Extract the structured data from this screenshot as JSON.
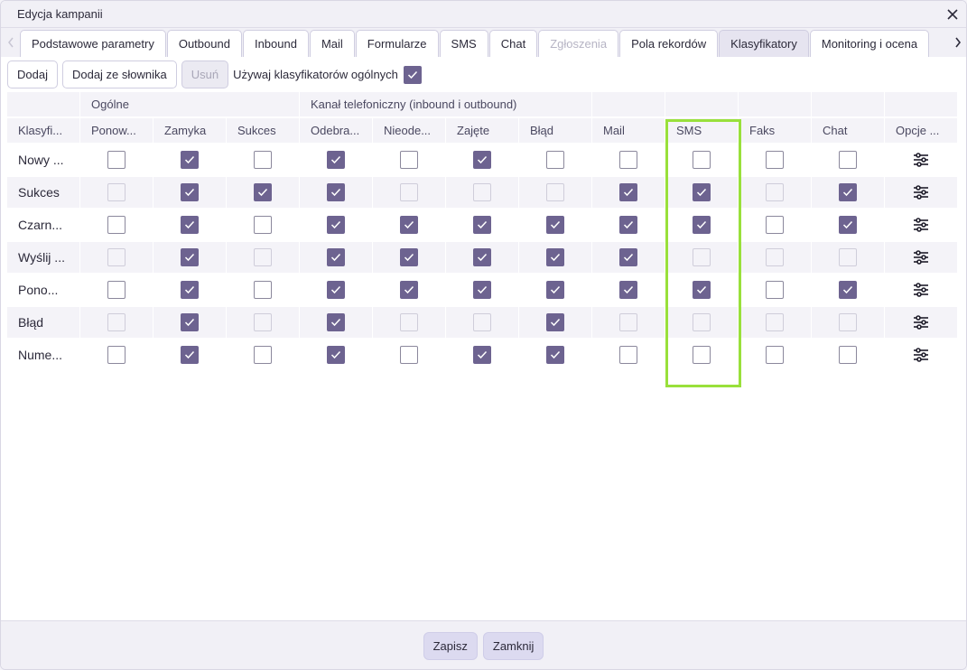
{
  "window": {
    "title": "Edycja kampanii",
    "close_icon": "close-icon"
  },
  "tabs": [
    {
      "label": "Podstawowe parametry",
      "state": "normal"
    },
    {
      "label": "Outbound",
      "state": "normal"
    },
    {
      "label": "Inbound",
      "state": "normal"
    },
    {
      "label": "Mail",
      "state": "normal"
    },
    {
      "label": "Formularze",
      "state": "normal"
    },
    {
      "label": "SMS",
      "state": "normal"
    },
    {
      "label": "Chat",
      "state": "normal"
    },
    {
      "label": "Zgłoszenia",
      "state": "disabled"
    },
    {
      "label": "Pola rekordów",
      "state": "normal"
    },
    {
      "label": "Klasyfikatory",
      "state": "active"
    },
    {
      "label": "Monitoring i ocena",
      "state": "normal"
    }
  ],
  "toolbar": {
    "add_label": "Dodaj",
    "add_from_dict_label": "Dodaj ze słownika",
    "remove_label": "Usuń",
    "use_general_label": "Używaj klasyfikatorów ogólnych",
    "use_general_checked": true
  },
  "table": {
    "group_headers": {
      "general": "Ogólne",
      "phone": "Kanał telefoniczny (inbound i outbound)"
    },
    "columns": [
      "Klasyfi...",
      "Ponow...",
      "Zamyka",
      "Sukces",
      "Odebra...",
      "Nieode...",
      "Zajęte",
      "Błąd",
      "Mail",
      "SMS",
      "Faks",
      "Chat",
      "Opcje ..."
    ],
    "rows": [
      {
        "name": "Nowy ...",
        "cells": [
          [
            0,
            0
          ],
          [
            1,
            0
          ],
          [
            0,
            0
          ],
          [
            1,
            0
          ],
          [
            0,
            0
          ],
          [
            1,
            0
          ],
          [
            0,
            0
          ],
          [
            0,
            0
          ],
          [
            0,
            0
          ],
          [
            0,
            0
          ],
          [
            0,
            0
          ]
        ]
      },
      {
        "name": "Sukces",
        "cells": [
          [
            0,
            1
          ],
          [
            1,
            0
          ],
          [
            1,
            0
          ],
          [
            1,
            0
          ],
          [
            0,
            1
          ],
          [
            0,
            1
          ],
          [
            0,
            1
          ],
          [
            1,
            0
          ],
          [
            1,
            0
          ],
          [
            0,
            1
          ],
          [
            1,
            0
          ]
        ]
      },
      {
        "name": "Czarn...",
        "cells": [
          [
            0,
            0
          ],
          [
            1,
            0
          ],
          [
            0,
            0
          ],
          [
            1,
            0
          ],
          [
            1,
            0
          ],
          [
            1,
            0
          ],
          [
            1,
            0
          ],
          [
            1,
            0
          ],
          [
            1,
            0
          ],
          [
            0,
            0
          ],
          [
            1,
            0
          ]
        ]
      },
      {
        "name": "Wyślij ...",
        "cells": [
          [
            0,
            1
          ],
          [
            1,
            0
          ],
          [
            0,
            1
          ],
          [
            1,
            0
          ],
          [
            1,
            0
          ],
          [
            1,
            0
          ],
          [
            1,
            0
          ],
          [
            1,
            0
          ],
          [
            0,
            1
          ],
          [
            0,
            1
          ],
          [
            0,
            1
          ]
        ]
      },
      {
        "name": "Pono...",
        "cells": [
          [
            0,
            0
          ],
          [
            1,
            0
          ],
          [
            0,
            0
          ],
          [
            1,
            0
          ],
          [
            1,
            0
          ],
          [
            1,
            0
          ],
          [
            1,
            0
          ],
          [
            1,
            0
          ],
          [
            1,
            0
          ],
          [
            0,
            0
          ],
          [
            1,
            0
          ]
        ]
      },
      {
        "name": "Błąd",
        "cells": [
          [
            0,
            1
          ],
          [
            1,
            0
          ],
          [
            0,
            1
          ],
          [
            1,
            0
          ],
          [
            0,
            1
          ],
          [
            0,
            1
          ],
          [
            1,
            0
          ],
          [
            0,
            1
          ],
          [
            0,
            1
          ],
          [
            0,
            1
          ],
          [
            0,
            1
          ]
        ]
      },
      {
        "name": "Nume...",
        "cells": [
          [
            0,
            0
          ],
          [
            1,
            0
          ],
          [
            0,
            0
          ],
          [
            1,
            0
          ],
          [
            0,
            0
          ],
          [
            1,
            0
          ],
          [
            1,
            0
          ],
          [
            0,
            0
          ],
          [
            0,
            0
          ],
          [
            0,
            0
          ],
          [
            0,
            0
          ]
        ]
      }
    ],
    "options_icon": "sliders-icon"
  },
  "highlight": {
    "column": "SMS",
    "color": "#99e03b"
  },
  "footer": {
    "save_label": "Zapisz",
    "close_label": "Zamknij"
  },
  "colors": {
    "accent": "#6d6390",
    "highlight": "#99e03b"
  }
}
